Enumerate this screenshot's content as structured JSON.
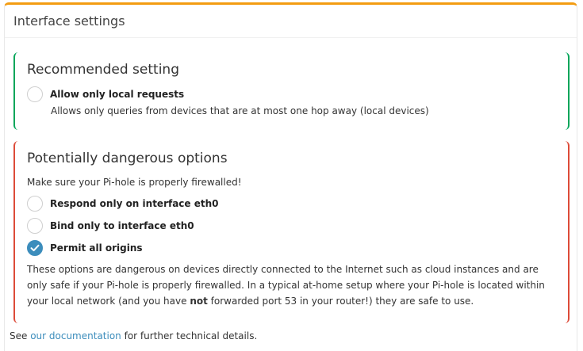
{
  "panel": {
    "title": "Interface settings"
  },
  "recommended": {
    "title": "Recommended setting",
    "options": [
      {
        "label": "Allow only local requests",
        "description": "Allows only queries from devices that are at most one hop away (local devices)",
        "checked": false
      }
    ]
  },
  "dangerous": {
    "title": "Potentially dangerous options",
    "warning": "Make sure your Pi-hole is properly firewalled!",
    "options": [
      {
        "label": "Respond only on interface eth0",
        "checked": false
      },
      {
        "label": "Bind only to interface eth0",
        "checked": false
      },
      {
        "label": "Permit all origins",
        "checked": true
      }
    ],
    "description_part1": "These options are dangerous on devices directly connected to the Internet such as cloud instances and are only safe if your Pi-hole is properly firewalled. In a typical at-home setup where your Pi-hole is located within your local network (and you have ",
    "description_bold": "not",
    "description_part2": " forwarded port 53 in your router!) they are safe to use."
  },
  "footer": {
    "prefix": "See ",
    "link_text": "our documentation",
    "suffix": " for further technical details."
  },
  "colors": {
    "panel_accent": "#f39c12",
    "recommended_border": "#00a65a",
    "dangerous_border": "#dd4b39",
    "checked_radio": "#3c8dbc",
    "link": "#3c8dbc"
  }
}
